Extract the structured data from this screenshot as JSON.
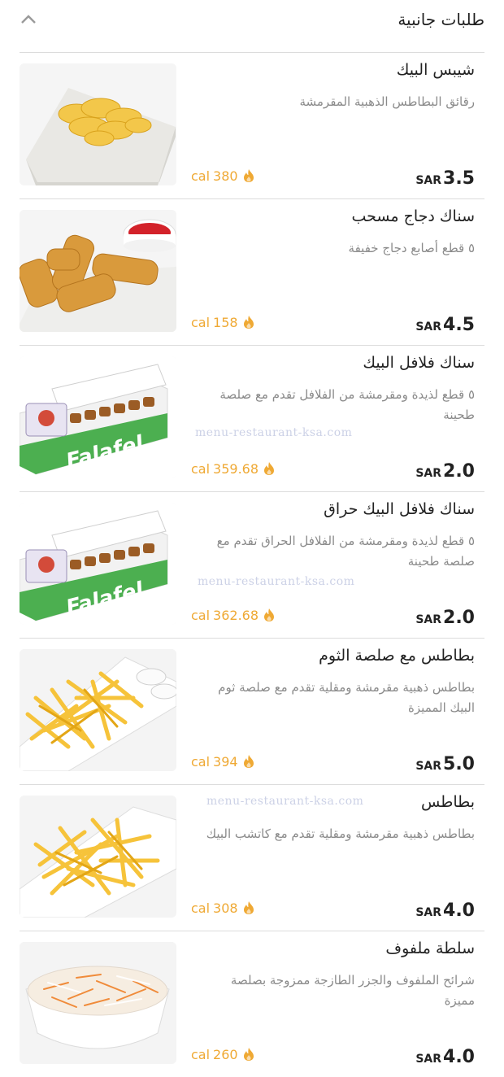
{
  "section": {
    "title": "طلبات جانبية",
    "collapse_icon": "chevron-up-icon"
  },
  "currency": "SAR",
  "cal_unit": "cal",
  "watermark": "menu-restaurant-ksa.com",
  "items": [
    {
      "name": "شيبس البيك",
      "description": "رقائق البطاطس الذهبية المقرمشة",
      "price": "3.5",
      "calories": "380"
    },
    {
      "name": "سناك دجاج مسحب",
      "description": "٥ قطع أصابع دجاج خفيفة",
      "price": "4.5",
      "calories": "158"
    },
    {
      "name": "سناك فلافل البيك",
      "description": "٥ قطع لذيدة ومقرمشة من الفلافل تقدم مع  صلصة طحينة",
      "price": "2.0",
      "calories": "359.68"
    },
    {
      "name": "سناك فلافل البيك حراق",
      "description": "٥ قطع لذيدة ومقرمشة من الفلافل الحراق تقدم مع صلصة طحينة",
      "price": "2.0",
      "calories": "362.68"
    },
    {
      "name": "بطاطس مع صلصة الثوم",
      "description": "بطاطس ذهبية مقرمشة ومقلية تقدم مع صلصة ثوم البيك المميزة",
      "price": "5.0",
      "calories": "394"
    },
    {
      "name": "بطاطس",
      "description": "بطاطس ذهبية مقرمشة ومقلية تقدم مع كاتشب البيك",
      "price": "4.0",
      "calories": "308"
    },
    {
      "name": "سلطة ملفوف",
      "description": "شرائح الملفوف والجزر الطازجة ممزوجة بصلصة مميزة",
      "price": "4.0",
      "calories": "260"
    }
  ],
  "colors": {
    "accent": "#efa934",
    "divider": "#dcdcdc",
    "muted_text": "#8a8a8a"
  }
}
